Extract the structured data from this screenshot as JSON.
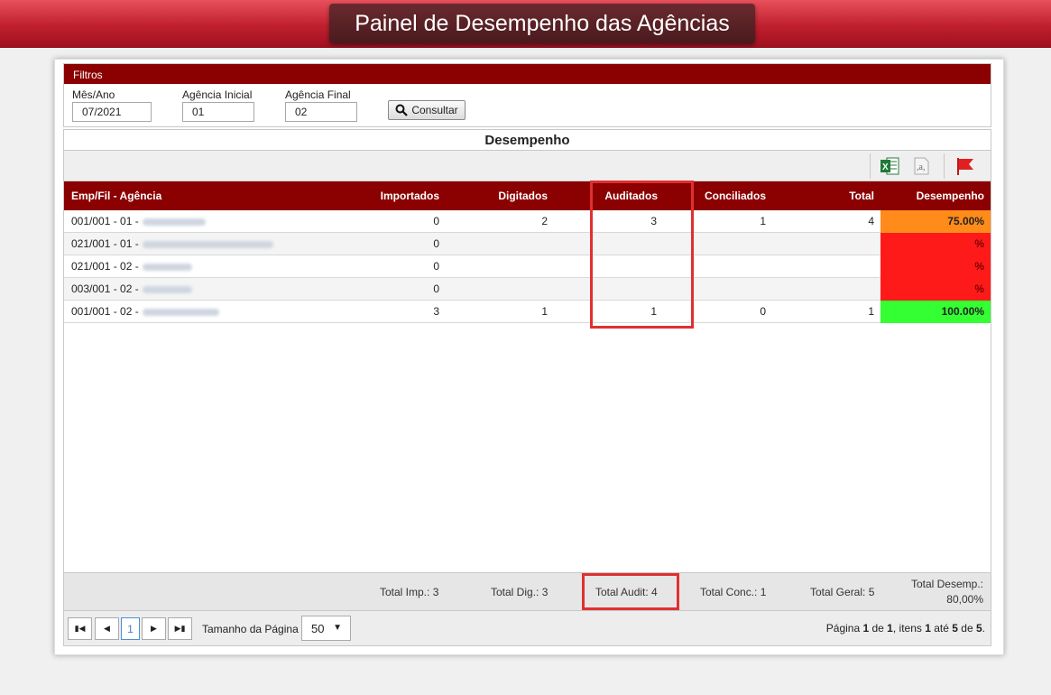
{
  "header": {
    "title": "Painel de Desempenho das Agências"
  },
  "filters": {
    "section_label": "Filtros",
    "mes_ano_label": "Mês/Ano",
    "mes_ano_value": "07/2021",
    "agencia_inicial_label": "Agência Inicial",
    "agencia_inicial_value": "01",
    "agencia_final_label": "Agência Final",
    "agencia_final_value": "02",
    "consultar_label": "Consultar"
  },
  "grid": {
    "title": "Desempenho",
    "columns": {
      "agencia": "Emp/Fil - Agência",
      "importados": "Importados",
      "digitados": "Digitados",
      "auditados": "Auditados",
      "conciliados": "Conciliados",
      "total": "Total",
      "desempenho": "Desempenho"
    },
    "rows": [
      {
        "agencia": "001/001 - 01 -",
        "importados": "0",
        "digitados": "2",
        "auditados": "3",
        "conciliados": "1",
        "total": "4",
        "desempenho": "75.00%",
        "status_color": "#ff8c1a"
      },
      {
        "agencia": "021/001 - 01 -",
        "importados": "0",
        "digitados": "",
        "auditados": "",
        "conciliados": "",
        "total": "",
        "desempenho": "%",
        "status_color": "#ff1a1a"
      },
      {
        "agencia": "021/001 - 02 -",
        "importados": "0",
        "digitados": "",
        "auditados": "",
        "conciliados": "",
        "total": "",
        "desempenho": "%",
        "status_color": "#ff1a1a"
      },
      {
        "agencia": "003/001 - 02 -",
        "importados": "0",
        "digitados": "",
        "auditados": "",
        "conciliados": "",
        "total": "",
        "desempenho": "%",
        "status_color": "#ff1a1a"
      },
      {
        "agencia": "001/001 - 02 -",
        "importados": "3",
        "digitados": "1",
        "auditados": "1",
        "conciliados": "0",
        "total": "1",
        "desempenho": "100.00%",
        "status_color": "#33ff33"
      }
    ],
    "totals": {
      "imp": "Total Imp.: 3",
      "dig": "Total Dig.: 3",
      "audit": "Total Audit: 4",
      "conc": "Total Conc.: 1",
      "geral": "Total Geral: 5",
      "desemp_label": "Total Desemp.:",
      "desemp_value": "80,00%"
    }
  },
  "pager": {
    "current_page": "1",
    "page_size_label": "Tamanho da Página",
    "page_size": "50",
    "info_prefix": "Página ",
    "info_page": "1",
    "info_of": " de ",
    "info_pages": "1",
    "info_items": ", itens ",
    "info_from": "1",
    "info_to_word": " até ",
    "info_to": "5",
    "info_de": " de ",
    "info_total": "5",
    "info_end": "."
  }
}
